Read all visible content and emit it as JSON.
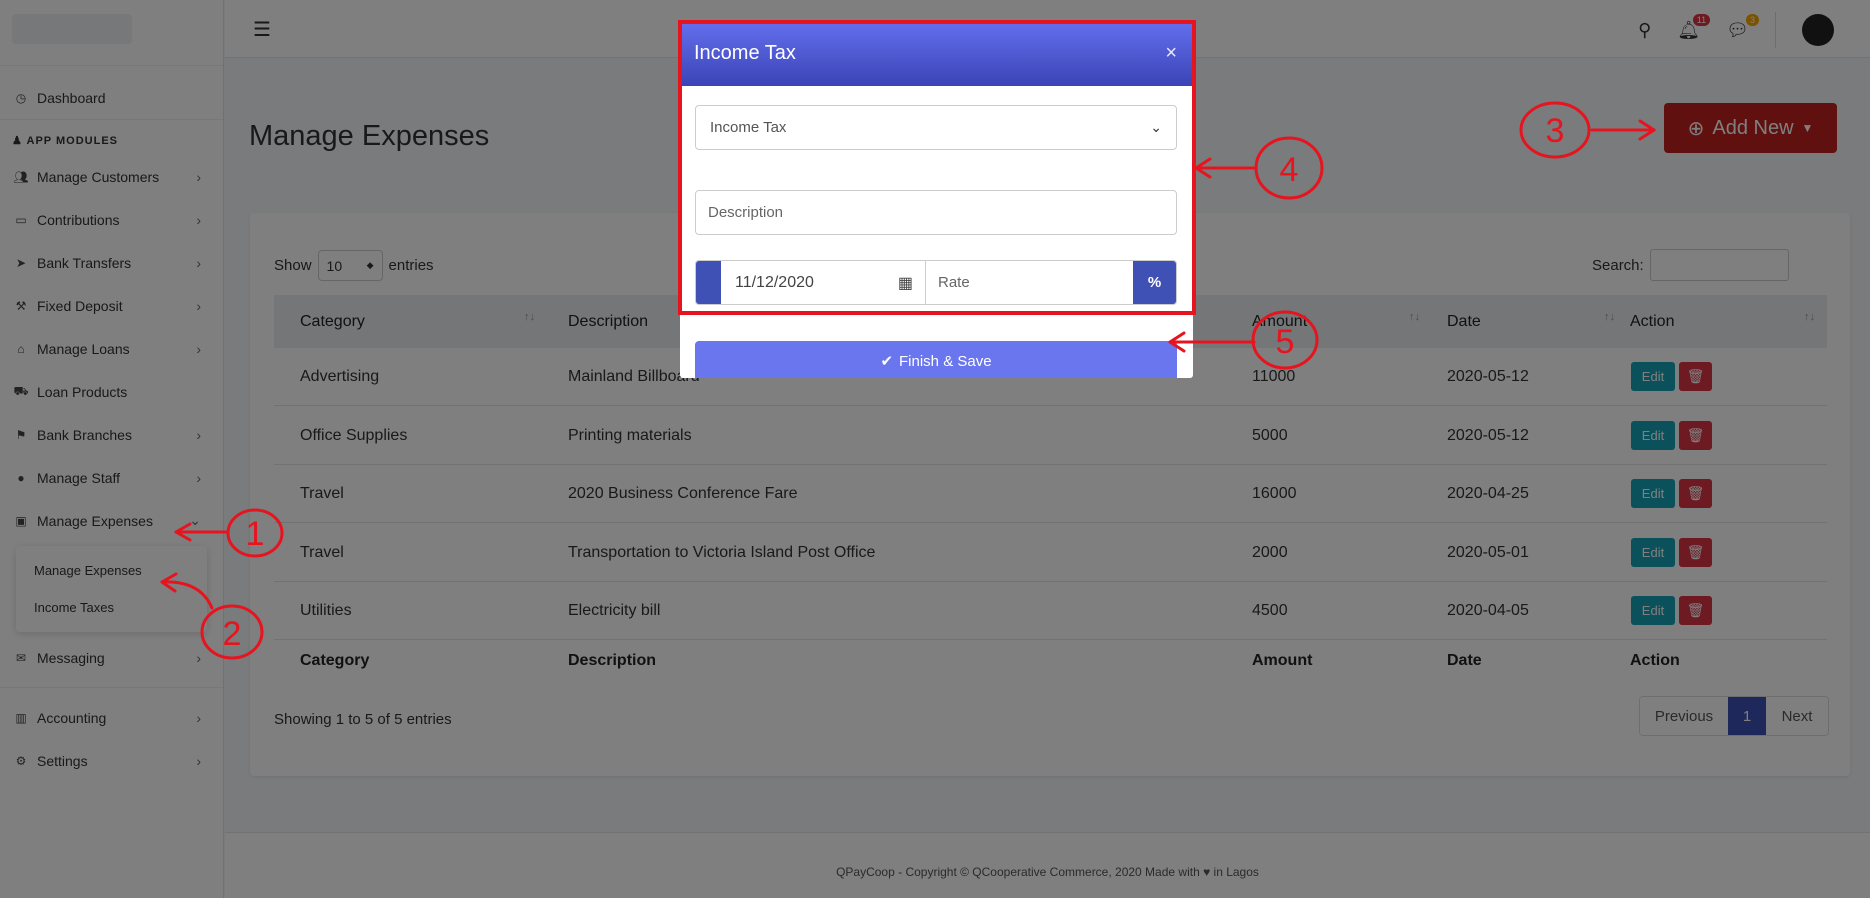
{
  "sidebar": {
    "dashboard": "Dashboard",
    "section_label": "APP MODULES",
    "items": [
      {
        "label": "Manage Customers",
        "icon": "users-icon"
      },
      {
        "label": "Contributions",
        "icon": "money-icon"
      },
      {
        "label": "Bank Transfers",
        "icon": "paper-plane-icon"
      },
      {
        "label": "Fixed Deposit",
        "icon": "hammer-icon"
      },
      {
        "label": "Manage Loans",
        "icon": "bank-icon"
      },
      {
        "label": "Loan Products",
        "icon": "cart-icon"
      },
      {
        "label": "Bank Branches",
        "icon": "flag-icon"
      },
      {
        "label": "Manage Staff",
        "icon": "user-icon"
      },
      {
        "label": "Manage Expenses",
        "icon": "calculator-icon"
      }
    ],
    "submenu": [
      "Manage Expenses",
      "Income Taxes"
    ],
    "messaging": "Messaging",
    "accounting": "Accounting",
    "settings": "Settings"
  },
  "topbar": {
    "notification_count": "11",
    "message_count": "3"
  },
  "page": {
    "title": "Manage Expenses",
    "add_new": "Add New"
  },
  "table": {
    "show_label": "Show",
    "entries_label": "entries",
    "page_length": "10",
    "search_label": "Search:",
    "columns": [
      "Category",
      "Description",
      "Amount",
      "Date",
      "Action"
    ],
    "rows": [
      {
        "category": "Advertising",
        "description": "Mainland Billboard",
        "amount": "11000",
        "date": "2020-05-12"
      },
      {
        "category": "Office Supplies",
        "description": "Printing materials",
        "amount": "5000",
        "date": "2020-05-12"
      },
      {
        "category": "Travel",
        "description": "2020 Business Conference Fare",
        "amount": "16000",
        "date": "2020-04-25"
      },
      {
        "category": "Travel",
        "description": "Transportation to Victoria Island Post Office",
        "amount": "2000",
        "date": "2020-05-01"
      },
      {
        "category": "Utilities",
        "description": "Electricity bill",
        "amount": "4500",
        "date": "2020-04-05"
      }
    ],
    "edit_label": "Edit",
    "showing": "Showing 1 to 5 of 5 entries",
    "pager": {
      "previous": "Previous",
      "current": "1",
      "next": "Next"
    }
  },
  "footer": {
    "text": "QPayCoop - Copyright © QCooperative Commerce, 2020  Made with ♥ in Lagos"
  },
  "modal": {
    "title": "Income Tax",
    "select_value": "Income Tax",
    "description_placeholder": "Description",
    "date_value": "11/12/2020",
    "rate_placeholder": "Rate",
    "percent": "%",
    "finish_label": "Finish & Save"
  },
  "annotations": [
    "1",
    "2",
    "3",
    "4",
    "5"
  ],
  "colors": {
    "primary": "#3f51b5",
    "danger": "#c0211d",
    "info": "#17a2b8",
    "annotation": "#e6141f"
  }
}
